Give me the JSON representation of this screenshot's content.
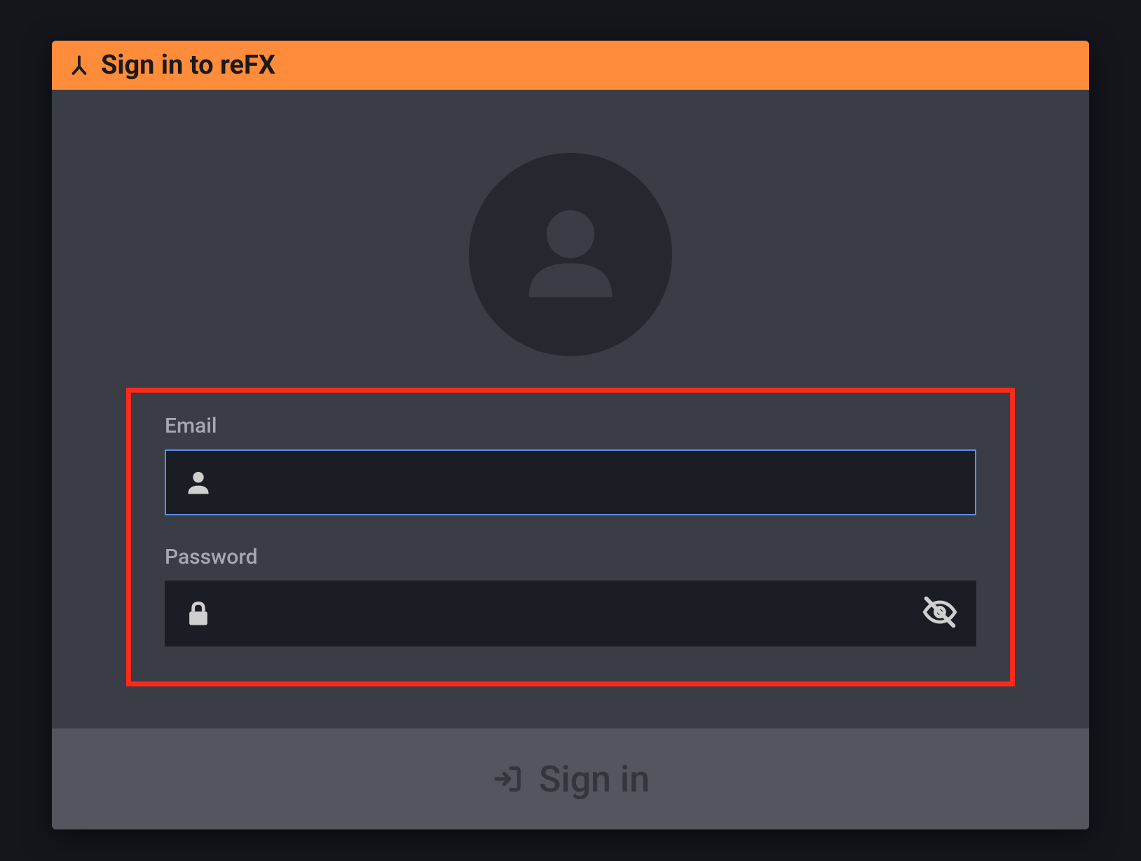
{
  "window": {
    "title": "Sign in to reFX"
  },
  "form": {
    "email": {
      "label": "Email",
      "value": ""
    },
    "password": {
      "label": "Password",
      "value": ""
    }
  },
  "footer": {
    "signin_label": "Sign in"
  },
  "colors": {
    "accent_orange": "#ff8c3a",
    "highlight_red": "#ff2a1a",
    "focus_blue": "#5a8ff0",
    "bg_dark": "#15161c",
    "panel": "#3a3c46",
    "input_bg": "#1b1d24",
    "footer_bg": "#53555f"
  }
}
